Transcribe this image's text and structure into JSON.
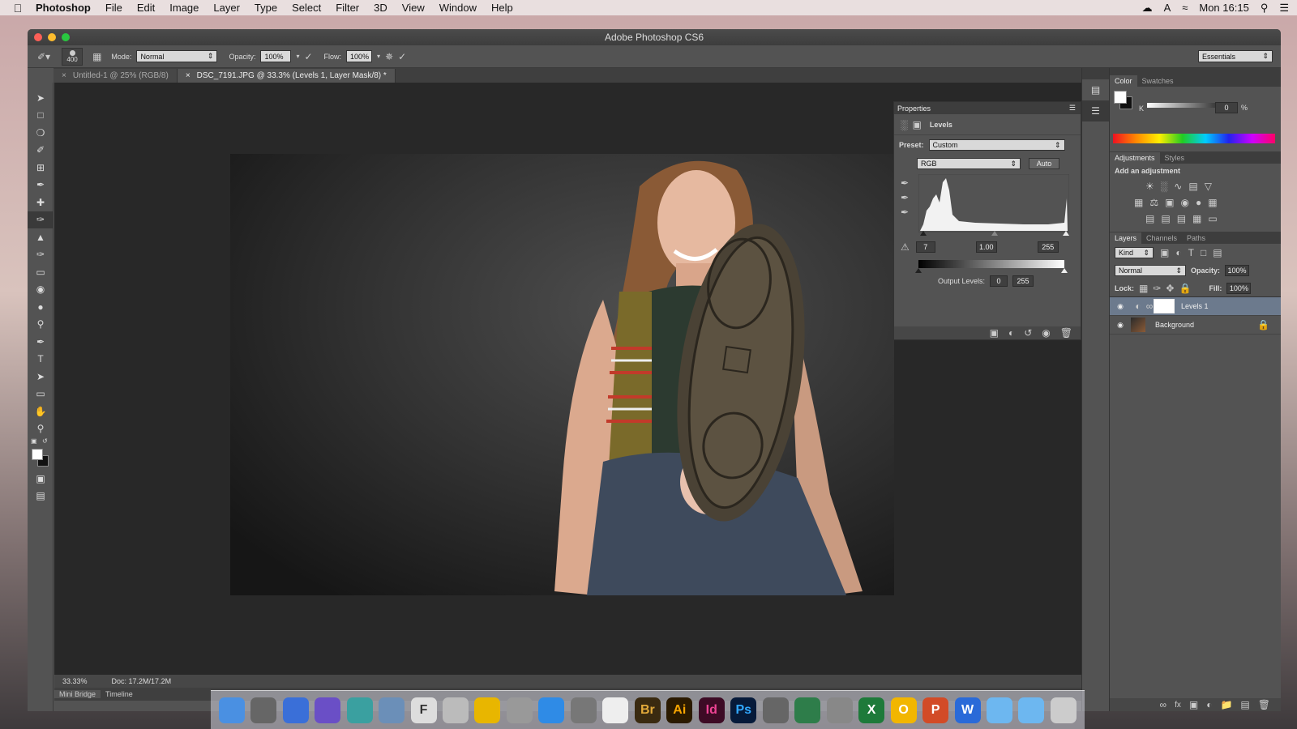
{
  "menubar": {
    "app": "Photoshop",
    "items": [
      "File",
      "Edit",
      "Image",
      "Layer",
      "Type",
      "Select",
      "Filter",
      "3D",
      "View",
      "Window",
      "Help"
    ],
    "clock": "Mon 16:15"
  },
  "window": {
    "title": "Adobe Photoshop CS6"
  },
  "options_bar": {
    "brush_size": "400",
    "mode_label": "Mode:",
    "mode_value": "Normal",
    "opacity_label": "Opacity:",
    "opacity_value": "100%",
    "flow_label": "Flow:",
    "flow_value": "100%",
    "workspace": "Essentials"
  },
  "doc_tabs": [
    {
      "label": "Untitled-1 @ 25% (RGB/8)"
    },
    {
      "label": "DSC_7191.JPG @ 33.3% (Levels 1, Layer Mask/8) *"
    }
  ],
  "status": {
    "zoom": "33.33%",
    "doc": "Doc: 17.2M/17.2M"
  },
  "bottom_tabs": [
    "Mini Bridge",
    "Timeline"
  ],
  "properties": {
    "tab": "Properties",
    "adjustment": "Levels",
    "preset_label": "Preset:",
    "preset_value": "Custom",
    "channel": "RGB",
    "auto_label": "Auto",
    "input_black": "7",
    "input_gamma": "1.00",
    "input_white": "255",
    "output_label": "Output Levels:",
    "output_black": "0",
    "output_white": "255"
  },
  "color_panel": {
    "tabs": [
      "Color",
      "Swatches"
    ],
    "channel_label": "K",
    "value": "0",
    "unit": "%"
  },
  "adjustments_panel": {
    "tabs": [
      "Adjustments",
      "Styles"
    ],
    "heading": "Add an adjustment"
  },
  "layers_panel": {
    "tabs": [
      "Layers",
      "Channels",
      "Paths"
    ],
    "filter": "Kind",
    "blend": "Normal",
    "opacity_label": "Opacity:",
    "opacity_value": "100%",
    "lock_label": "Lock:",
    "fill_label": "Fill:",
    "fill_value": "100%",
    "layers": [
      {
        "name": "Levels 1",
        "selected": true
      },
      {
        "name": "Background",
        "selected": false
      }
    ]
  },
  "dock": {
    "apps": [
      {
        "icon": "finder-icon",
        "label": ""
      },
      {
        "icon": "photo-booth-icon",
        "label": ""
      },
      {
        "icon": "dvd-player-icon",
        "label": ""
      },
      {
        "icon": "imovie-icon",
        "label": ""
      },
      {
        "icon": "iphoto-icon",
        "label": ""
      },
      {
        "icon": "preview-icon",
        "label": ""
      },
      {
        "icon": "font-book-icon",
        "label": "F"
      },
      {
        "icon": "mail-icon",
        "label": ""
      },
      {
        "icon": "chrome-icon",
        "label": ""
      },
      {
        "icon": "launchpad-icon",
        "label": ""
      },
      {
        "icon": "safari-icon",
        "label": ""
      },
      {
        "icon": "system-prefs-icon",
        "label": ""
      },
      {
        "icon": "acrobat-icon",
        "label": ""
      },
      {
        "icon": "bridge-icon",
        "label": "Br"
      },
      {
        "icon": "illustrator-icon",
        "label": "Ai"
      },
      {
        "icon": "indesign-icon",
        "label": "Id"
      },
      {
        "icon": "photoshop-icon",
        "label": "Ps"
      },
      {
        "icon": "keynote-icon",
        "label": ""
      },
      {
        "icon": "numbers-icon",
        "label": ""
      },
      {
        "icon": "pencil-app-icon",
        "label": ""
      },
      {
        "icon": "excel-icon",
        "label": "X"
      },
      {
        "icon": "outlook-icon",
        "label": "O"
      },
      {
        "icon": "powerpoint-icon",
        "label": "P"
      },
      {
        "icon": "word-icon",
        "label": "W"
      },
      {
        "icon": "applications-folder-icon",
        "label": ""
      },
      {
        "icon": "documents-folder-icon",
        "label": ""
      },
      {
        "icon": "trash-icon",
        "label": ""
      }
    ]
  },
  "colors": {
    "selected_layer": "#6c7a8d",
    "panel": "#535353",
    "canvas": "#282828"
  }
}
